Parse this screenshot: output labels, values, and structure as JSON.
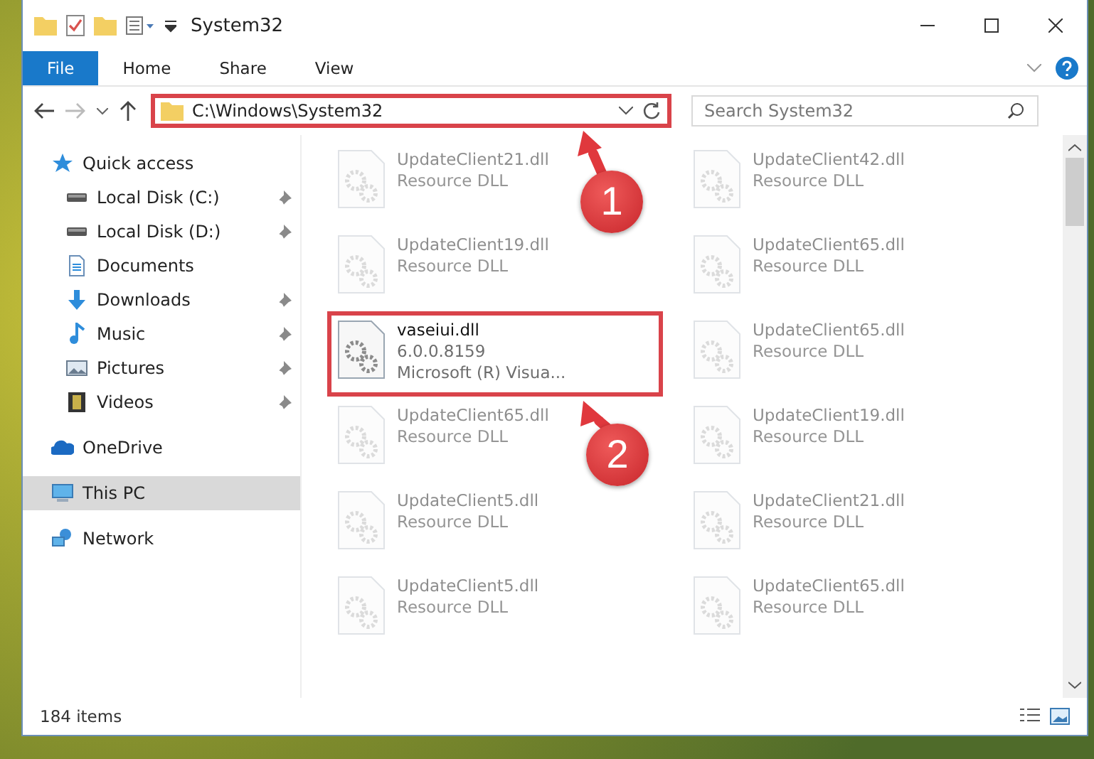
{
  "window": {
    "title": "System32"
  },
  "ribbon": {
    "tabs": [
      {
        "label": "File",
        "selected": true
      },
      {
        "label": "Home",
        "selected": false
      },
      {
        "label": "Share",
        "selected": false
      },
      {
        "label": "View",
        "selected": false
      }
    ]
  },
  "address": {
    "path": "C:\\Windows\\System32",
    "highlighted": true
  },
  "search": {
    "placeholder": "Search System32"
  },
  "nav": [
    {
      "label": "Quick access",
      "pinned": false,
      "selected": false,
      "children": [
        {
          "label": "Local Disk (C:)",
          "pinned": true,
          "selected": false
        },
        {
          "label": "Local Disk (D:)",
          "pinned": true,
          "selected": false
        },
        {
          "label": "Documents",
          "pinned": false,
          "selected": false
        },
        {
          "label": "Downloads",
          "pinned": true,
          "selected": false
        },
        {
          "label": "Music",
          "pinned": true,
          "selected": false
        },
        {
          "label": "Pictures",
          "pinned": true,
          "selected": false
        },
        {
          "label": "Videos",
          "pinned": true,
          "selected": false
        }
      ]
    },
    {
      "label": "OneDrive",
      "pinned": false,
      "selected": false
    },
    {
      "label": "This PC",
      "pinned": false,
      "selected": true
    },
    {
      "label": "Network",
      "pinned": false,
      "selected": false
    }
  ],
  "files": [
    {
      "name": "UpdateClient21.dll",
      "details": [
        "Resource DLL"
      ],
      "dimmed": true,
      "highlighted": false
    },
    {
      "name": "UpdateClient42.dll",
      "details": [
        "Resource DLL"
      ],
      "dimmed": true,
      "highlighted": false
    },
    {
      "name": "UpdateClient19.dll",
      "details": [
        "Resource DLL"
      ],
      "dimmed": true,
      "highlighted": false
    },
    {
      "name": "UpdateClient65.dll",
      "details": [
        "Resource DLL"
      ],
      "dimmed": true,
      "highlighted": false
    },
    {
      "name": "vaseiui.dll",
      "details": [
        "6.0.0.8159",
        "Microsoft (R) Visua..."
      ],
      "dimmed": false,
      "highlighted": true
    },
    {
      "name": "UpdateClient65.dll",
      "details": [
        "Resource DLL"
      ],
      "dimmed": true,
      "highlighted": false
    },
    {
      "name": "UpdateClient65.dll",
      "details": [
        "Resource DLL"
      ],
      "dimmed": true,
      "highlighted": false
    },
    {
      "name": "UpdateClient19.dll",
      "details": [
        "Resource DLL"
      ],
      "dimmed": true,
      "highlighted": false
    },
    {
      "name": "UpdateClient5.dll",
      "details": [
        "Resource DLL"
      ],
      "dimmed": true,
      "highlighted": false
    },
    {
      "name": "UpdateClient21.dll",
      "details": [
        "Resource DLL"
      ],
      "dimmed": true,
      "highlighted": false
    },
    {
      "name": "UpdateClient5.dll",
      "details": [
        "Resource DLL"
      ],
      "dimmed": true,
      "highlighted": false
    },
    {
      "name": "UpdateClient65.dll",
      "details": [
        "Resource DLL"
      ],
      "dimmed": true,
      "highlighted": false
    }
  ],
  "status_bar": {
    "count": "184 items"
  },
  "annotations": [
    {
      "number": "1"
    },
    {
      "number": "2"
    }
  ]
}
